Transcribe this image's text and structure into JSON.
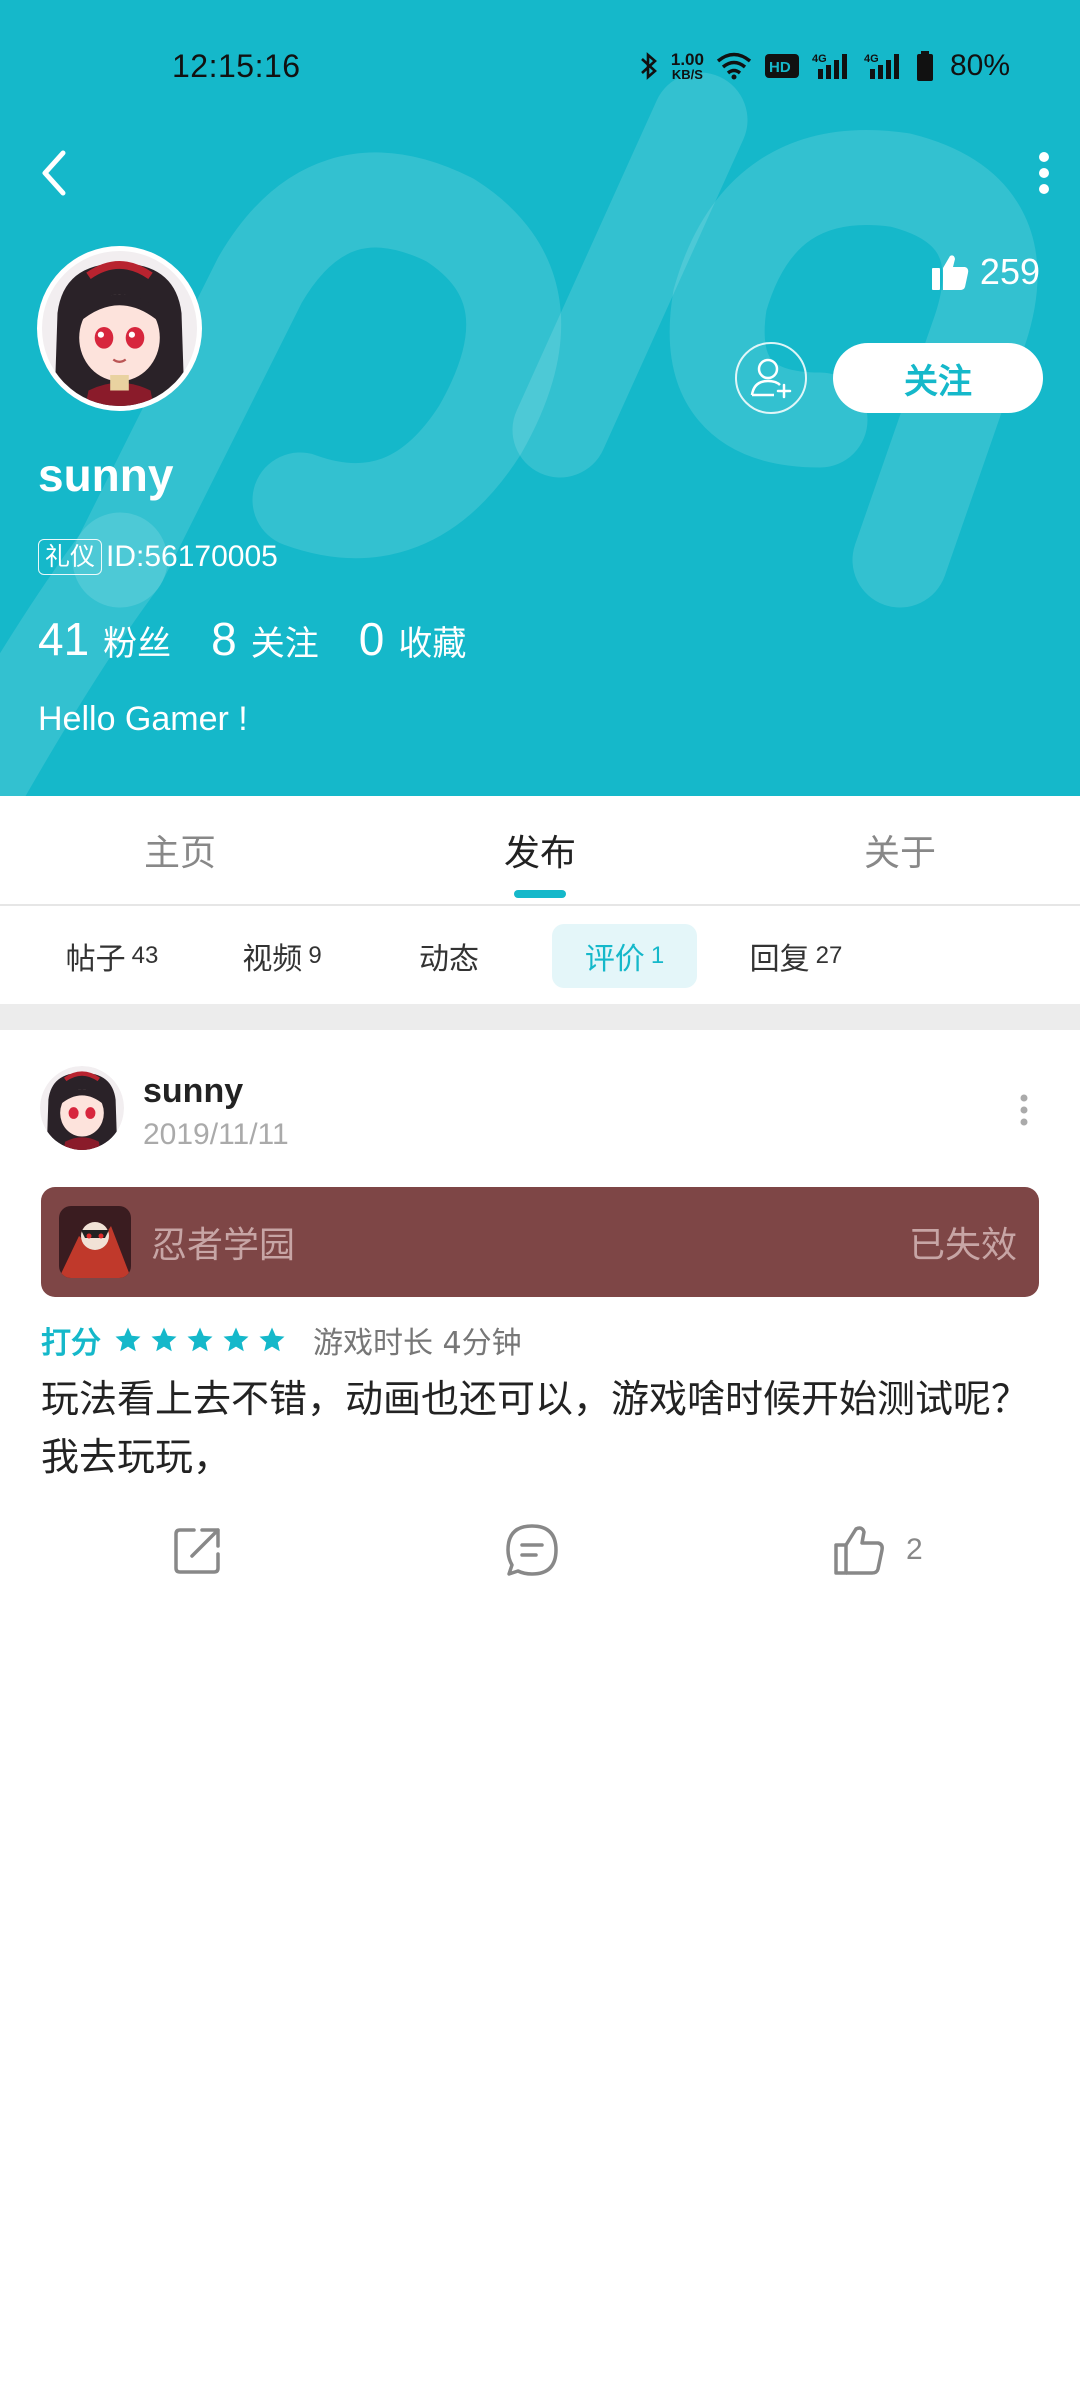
{
  "status_bar": {
    "time": "12:15:16",
    "net_speed_value": "1.00",
    "net_speed_unit": "KB/S",
    "battery": "80%",
    "icons": [
      "bluetooth-icon",
      "net-speed",
      "wifi-icon",
      "hd-icon",
      "signal-4g-icon",
      "signal-4g-icon",
      "battery-icon"
    ]
  },
  "profile": {
    "username": "sunny",
    "likes": "259",
    "follow_label": "关注",
    "id_badge": "礼仪",
    "id_text": "ID:56170005",
    "stats": [
      {
        "value": "41",
        "label": "粉丝"
      },
      {
        "value": "8",
        "label": "关注"
      },
      {
        "value": "0",
        "label": "收藏"
      }
    ],
    "bio": "Hello Gamer !"
  },
  "tabs": [
    {
      "label": "主页"
    },
    {
      "label": "发布",
      "active": true
    },
    {
      "label": "关于"
    }
  ],
  "subtabs": [
    {
      "label": "帖子",
      "count": "43"
    },
    {
      "label": "视频",
      "count": "9"
    },
    {
      "label": "动态",
      "count": ""
    },
    {
      "label": "评价",
      "count": "1",
      "active": true
    },
    {
      "label": "回复",
      "count": "27"
    }
  ],
  "review": {
    "author": "sunny",
    "date": "2019/11/11",
    "game_name": "忍者学园",
    "game_status": "已失效",
    "rating_label": "打分",
    "stars": 5,
    "playtime": "游戏时长 4分钟",
    "text": "玩法看上去不错，动画也还可以，游戏啥时候开始测试呢？我去玩玩，",
    "like_count": "2"
  },
  "colors": {
    "accent": "#15B8CA",
    "game_card_bg": "#7E4646",
    "divider": "#ECECEC"
  }
}
